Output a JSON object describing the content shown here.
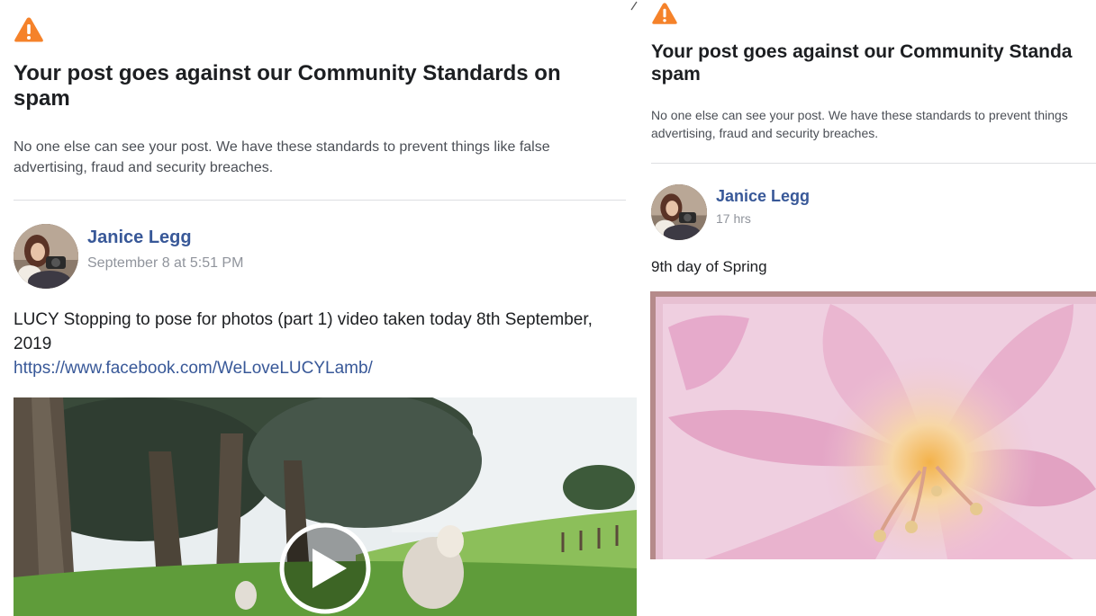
{
  "left": {
    "warning_icon": "warning-triangle-icon",
    "title": "Your post goes against our Community Standards on spam",
    "description": "No one else can see your post. We have these standards to prevent things like false advertising, fraud and security breaches.",
    "author": "Janice Legg",
    "timestamp": "September 8 at 5:51 PM",
    "post_text": "LUCY Stopping to pose for photos (part 1) video taken today 8th September, 2019",
    "post_link": "https://www.facebook.com/WeLoveLUCYLamb/",
    "media_icon": "play-icon"
  },
  "right": {
    "warning_icon": "warning-triangle-icon",
    "title_line1": "Your post goes against our Community Standa",
    "title_line2": "spam",
    "description_line1": "No one else can see your post. We have these standards to prevent things",
    "description_line2": "advertising, fraud and security breaches.",
    "author": "Janice Legg",
    "timestamp": "17 hrs",
    "post_text": "9th day of Spring"
  },
  "colors": {
    "warning": "#f5822a",
    "link": "#385898",
    "muted": "#90949c",
    "divider": "#dddfe2"
  }
}
